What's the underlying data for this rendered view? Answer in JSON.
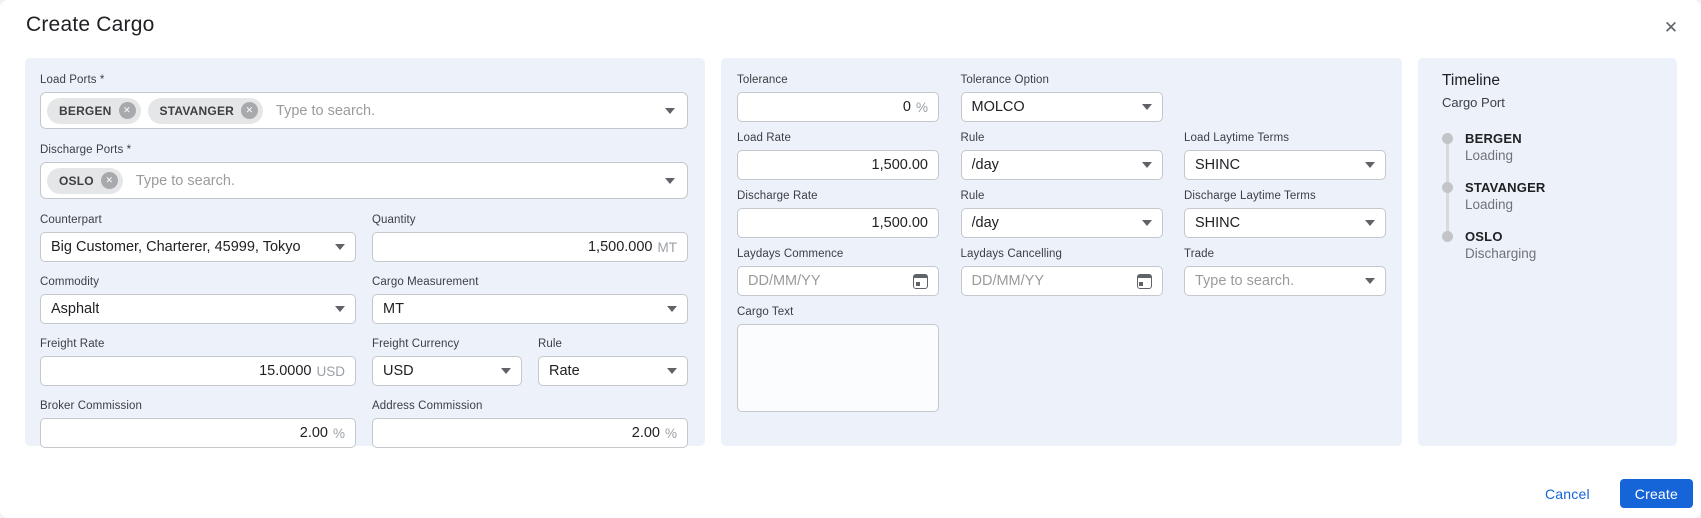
{
  "dialog": {
    "title": "Create Cargo"
  },
  "icons": {
    "close": "✕",
    "chip_remove": "✕"
  },
  "colors": {
    "accent": "#1665d8",
    "panel_bg": "#edf2fa",
    "field_border": "#c4c8cc",
    "chip_bg": "#e5e6e8",
    "timeline_dot": "#c2c4c7"
  },
  "left_panel": {
    "load_ports": {
      "label": "Load Ports *",
      "chips": [
        "BERGEN",
        "STAVANGER"
      ],
      "placeholder": "Type to search."
    },
    "discharge_ports": {
      "label": "Discharge Ports *",
      "chips": [
        "OSLO"
      ],
      "placeholder": "Type to search."
    },
    "counterpart": {
      "label": "Counterpart",
      "value": "Big Customer, Charterer, 45999, Tokyo"
    },
    "quantity": {
      "label": "Quantity",
      "value": "1,500.000",
      "unit": "MT"
    },
    "commodity": {
      "label": "Commodity",
      "value": "Asphalt"
    },
    "cargo_measurement": {
      "label": "Cargo Measurement",
      "value": "MT"
    },
    "freight_rate": {
      "label": "Freight Rate",
      "value": "15.0000",
      "unit": "USD"
    },
    "freight_currency": {
      "label": "Freight Currency",
      "value": "USD"
    },
    "rule": {
      "label": "Rule",
      "value": "Rate"
    },
    "broker_commission": {
      "label": "Broker Commission",
      "value": "2.00",
      "unit": "%"
    },
    "address_commission": {
      "label": "Address Commission",
      "value": "2.00",
      "unit": "%"
    }
  },
  "middle_panel": {
    "tolerance": {
      "label": "Tolerance",
      "value": "0",
      "unit": "%"
    },
    "tolerance_option": {
      "label": "Tolerance Option",
      "value": "MOLCO"
    },
    "load_rate": {
      "label": "Load Rate",
      "value": "1,500.00"
    },
    "load_rule": {
      "label": "Rule",
      "value": "/day"
    },
    "load_laytime_terms": {
      "label": "Load Laytime Terms",
      "value": "SHINC"
    },
    "discharge_rate": {
      "label": "Discharge Rate",
      "value": "1,500.00"
    },
    "discharge_rule": {
      "label": "Rule",
      "value": "/day"
    },
    "discharge_laytime_terms": {
      "label": "Discharge Laytime Terms",
      "value": "SHINC"
    },
    "laydays_commence": {
      "label": "Laydays Commence",
      "placeholder": "DD/MM/YY"
    },
    "laydays_cancelling": {
      "label": "Laydays Cancelling",
      "placeholder": "DD/MM/YY"
    },
    "trade": {
      "label": "Trade",
      "placeholder": "Type to search."
    },
    "cargo_text": {
      "label": "Cargo Text",
      "value": ""
    }
  },
  "timeline_panel": {
    "title": "Timeline",
    "subtitle": "Cargo Port",
    "items": [
      {
        "port": "BERGEN",
        "activity": "Loading"
      },
      {
        "port": "STAVANGER",
        "activity": "Loading"
      },
      {
        "port": "OSLO",
        "activity": "Discharging"
      }
    ]
  },
  "footer": {
    "cancel_label": "Cancel",
    "create_label": "Create"
  }
}
